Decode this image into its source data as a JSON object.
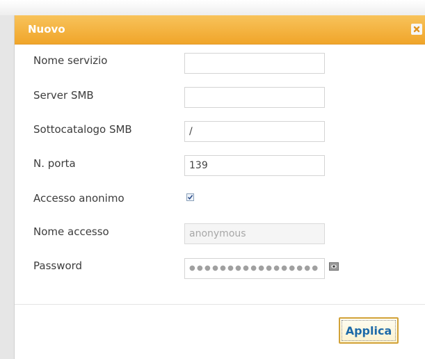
{
  "dialog": {
    "title": "Nuovo",
    "close_icon": "close-x-icon"
  },
  "form": {
    "service_name": {
      "label": "Nome servizio",
      "value": ""
    },
    "smb_server": {
      "label": "Server SMB",
      "value": ""
    },
    "smb_subcatalog": {
      "label": "Sottocatalogo SMB",
      "value": "/"
    },
    "port": {
      "label": "N. porta",
      "value": "139"
    },
    "anonymous_access": {
      "label": "Accesso anonimo",
      "checked": true
    },
    "login_name": {
      "label": "Nome accesso",
      "value": "anonymous"
    },
    "password": {
      "label": "Password",
      "masked_value": "●●●●●●●●●●●●●●●●●",
      "reveal_icon": "eye-icon"
    }
  },
  "actions": {
    "apply_label": "Applica"
  },
  "colors": {
    "titlebar": "#f0a52a",
    "apply_text": "#1e6aa8"
  }
}
